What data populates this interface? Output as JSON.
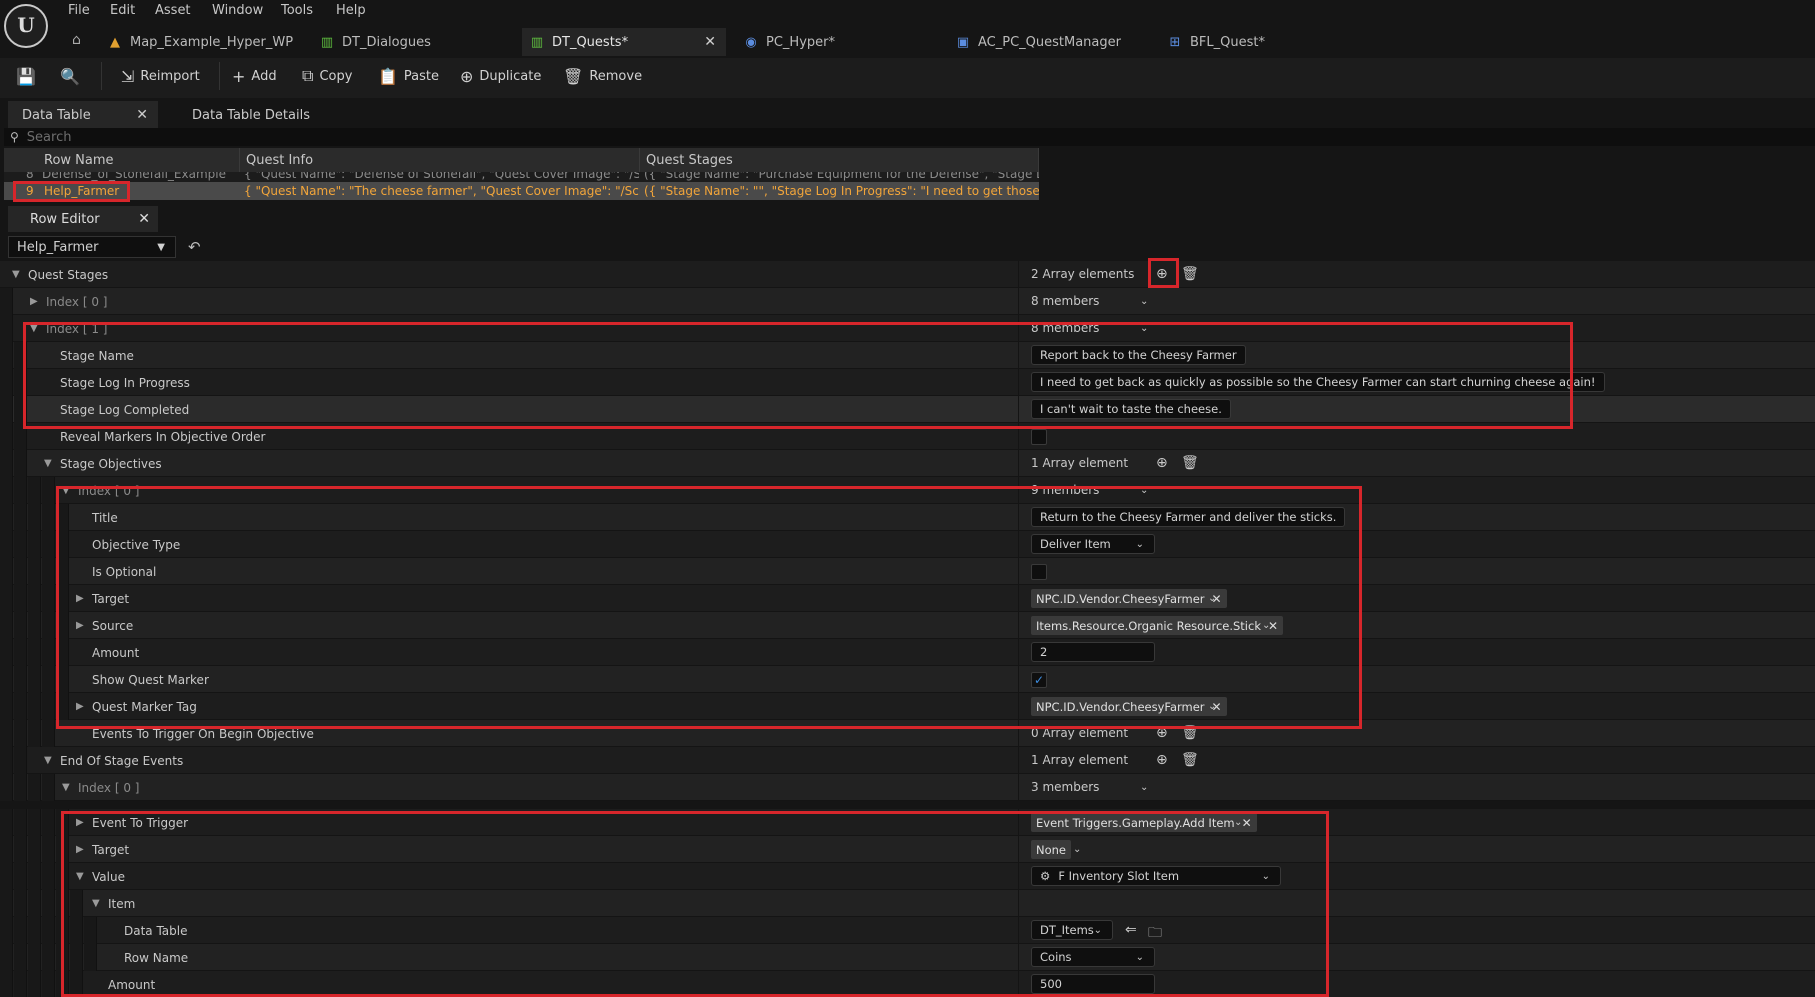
{
  "menu": [
    "File",
    "Edit",
    "Asset",
    "Window",
    "Tools",
    "Help"
  ],
  "logo_text": "U",
  "tabs": [
    {
      "label": "Map_Example_Hyper_WP",
      "icon": "level-icon"
    },
    {
      "label": "DT_Dialogues",
      "icon": "datatable-icon"
    },
    {
      "label": "DT_Quests*",
      "icon": "datatable-icon"
    },
    {
      "label": "PC_Hyper*",
      "icon": "gamepad-icon"
    },
    {
      "label": "AC_PC_QuestManager",
      "icon": "blueprint-component-icon"
    },
    {
      "label": "BFL_Quest*",
      "icon": "function-library-icon"
    }
  ],
  "toolbar": {
    "reimport": "Reimport",
    "add": "Add",
    "copy": "Copy",
    "paste": "Paste",
    "duplicate": "Duplicate",
    "remove": "Remove"
  },
  "panel_tabs": {
    "data_table": "Data Table",
    "details": "Data Table Details"
  },
  "search": {
    "placeholder": "Search"
  },
  "grid": {
    "headers": [
      "Row Name",
      "Quest Info",
      "Quest Stages"
    ],
    "prev_row": {
      "index": "8",
      "name": "Defense_of_Stonefall_Example",
      "info": "{ \"Quest Name\": \"Defense of Stonefall\", \"Quest Cover Image\": \"/Script/Engi",
      "stages": "({ \"Stage Name\": \"Purchase Equipment for the Defense\", \"Stage Log In Pro"
    },
    "selected_row": {
      "index": "9",
      "name": "Help_Farmer",
      "info": "{ \"Quest Name\": \"The cheese farmer\", \"Quest Cover Image\": \"/Script/Engine",
      "stages": "({ \"Stage Name\": \"\", \"Stage Log In Progress\": \"I need to get those sticks...\","
    }
  },
  "row_editor": {
    "tab": "Row Editor",
    "selected": "Help_Farmer"
  },
  "props": {
    "quest_stages": {
      "label": "Quest Stages",
      "value": "2 Array elements"
    },
    "index0": {
      "label": "Index [ 0 ]",
      "value": "8 members"
    },
    "index1": {
      "label": "Index [ 1 ]",
      "value": "8 members"
    },
    "stage_name": {
      "label": "Stage Name",
      "value": "Report back to the Cheesy Farmer"
    },
    "stage_log_progress": {
      "label": "Stage Log In Progress",
      "value": "I need to get back as quickly as possible so the Cheesy Farmer can start churning cheese again!"
    },
    "stage_log_completed": {
      "label": "Stage Log Completed",
      "value": "I can't wait to taste the cheese."
    },
    "reveal_markers": {
      "label": "Reveal Markers In Objective Order"
    },
    "stage_objectives": {
      "label": "Stage Objectives",
      "value": "1 Array element"
    },
    "obj_index0": {
      "label": "Index [ 0 ]",
      "value": "9 members"
    },
    "title": {
      "label": "Title",
      "value": "Return to the Cheesy Farmer and deliver the sticks."
    },
    "objective_type": {
      "label": "Objective Type",
      "value": "Deliver Item"
    },
    "is_optional": {
      "label": "Is Optional"
    },
    "target": {
      "label": "Target",
      "value": "NPC.ID.Vendor.CheesyFarmer"
    },
    "source": {
      "label": "Source",
      "value": "Items.Resource.Organic Resource.Stick"
    },
    "amount": {
      "label": "Amount",
      "value": "2"
    },
    "show_marker": {
      "label": "Show Quest Marker"
    },
    "marker_tag": {
      "label": "Quest Marker Tag",
      "value": "NPC.ID.Vendor.CheesyFarmer"
    },
    "events_begin": {
      "label": "Events To Trigger On Begin Objective",
      "value": "0 Array element"
    },
    "end_events": {
      "label": "End Of Stage Events",
      "value": "1 Array element"
    },
    "end_index0": {
      "label": "Index [ 0 ]",
      "value": "3 members"
    },
    "event_trigger": {
      "label": "Event To Trigger",
      "value": "Event Triggers.Gameplay.Add Item"
    },
    "ev_target": {
      "label": "Target",
      "value": "None"
    },
    "ev_value": {
      "label": "Value",
      "value": "F Inventory Slot Item"
    },
    "item": {
      "label": "Item"
    },
    "data_table": {
      "label": "Data Table",
      "value": "DT_Items"
    },
    "row_name": {
      "label": "Row Name",
      "value": "Coins"
    },
    "ev_amount": {
      "label": "Amount",
      "value": "500"
    }
  },
  "colors": {
    "highlight": "#d7262b",
    "selected_text": "#f2a53a",
    "check": "#3d8de0"
  }
}
